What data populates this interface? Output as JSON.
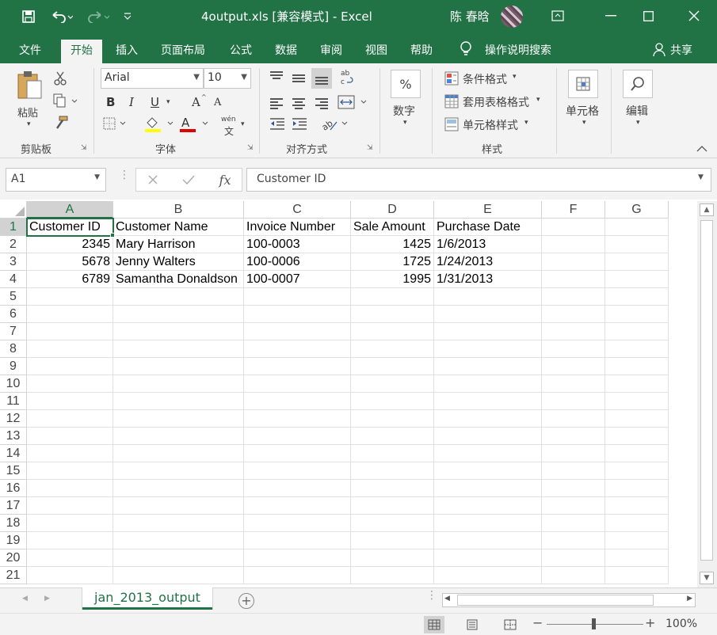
{
  "titlebar": {
    "title": "4output.xls  [兼容模式]  -  Excel",
    "user": "陈 春晗",
    "icons": [
      "save-icon",
      "undo-icon",
      "redo-icon",
      "customize-icon",
      "ribbon-display-icon",
      "minimize-icon",
      "maximize-icon",
      "close-icon"
    ]
  },
  "tabs": [
    "文件",
    "开始",
    "插入",
    "页面布局",
    "公式",
    "数据",
    "审阅",
    "视图",
    "帮助"
  ],
  "active_tab": "开始",
  "tell_me": "操作说明搜索",
  "share": "共享",
  "ribbon": {
    "clipboard": {
      "label": "剪贴板",
      "paste": "粘贴"
    },
    "font": {
      "label": "字体",
      "name": "Arial",
      "size": "10",
      "bold": "B",
      "italic": "I",
      "underline": "U",
      "grow": "A",
      "shrink": "A",
      "font_color": "A",
      "phonetic": "wén"
    },
    "alignment": {
      "label": "对齐方式"
    },
    "number": {
      "label": "数字",
      "symbol": "%"
    },
    "styles": {
      "label": "样式",
      "conditional": "条件格式",
      "table": "套用表格格式",
      "cell_styles": "单元格样式"
    },
    "cells": {
      "label": "单元格"
    },
    "editing": {
      "label": "编辑"
    }
  },
  "formula_bar": {
    "name_box": "A1",
    "content": "Customer ID",
    "fx": "fx"
  },
  "columns": [
    "A",
    "B",
    "C",
    "D",
    "E",
    "F",
    "G"
  ],
  "row_numbers": [
    "1",
    "2",
    "3",
    "4",
    "5",
    "6",
    "7",
    "8",
    "9",
    "10",
    "11",
    "12",
    "13",
    "14",
    "15",
    "16",
    "17",
    "18",
    "19",
    "20",
    "21"
  ],
  "cells": [
    [
      "Customer ID",
      "Customer Name",
      "Invoice Number",
      "Sale Amount",
      "Purchase Date",
      "",
      ""
    ],
    [
      "2345",
      "Mary Harrison",
      "100-0003",
      "1425",
      "1/6/2013",
      "",
      ""
    ],
    [
      "5678",
      "Jenny Walters",
      "100-0006",
      "1725",
      "1/24/2013",
      "",
      ""
    ],
    [
      "6789",
      "Samantha Donaldson",
      "100-0007",
      "1995",
      "1/31/2013",
      "",
      ""
    ]
  ],
  "numeric_columns": [
    0,
    3
  ],
  "sheet_tab": "jan_2013_output",
  "zoom": "100%",
  "colors": {
    "accent": "#217346",
    "header_selected": "#d2d2d2"
  }
}
